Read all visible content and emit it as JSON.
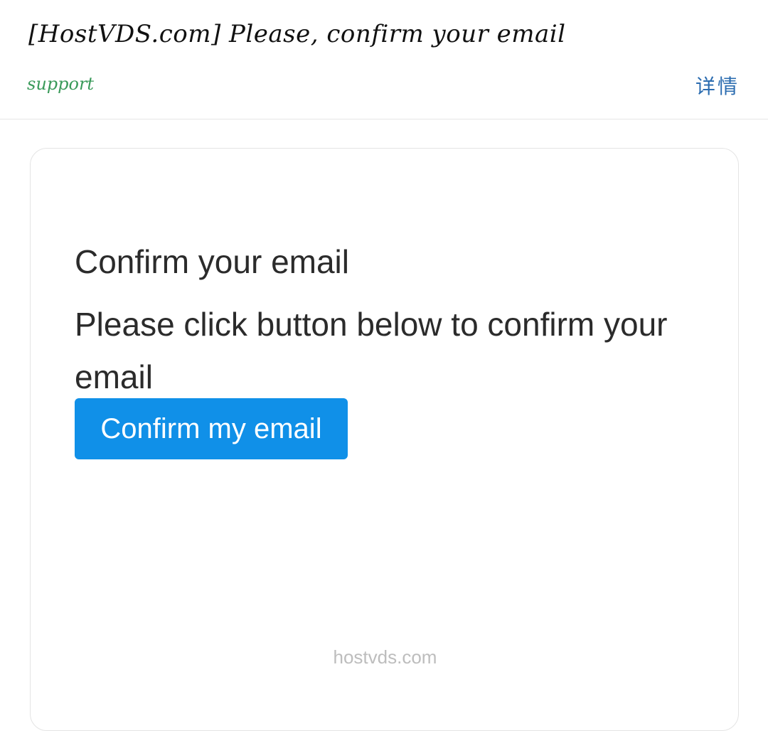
{
  "header": {
    "subject": "[HostVDS.com] Please, confirm your email",
    "sender": "support",
    "details_label": "详情"
  },
  "email": {
    "title": "Confirm your email",
    "body": "Please click button below to confirm your email",
    "button_label": "Confirm my email",
    "footer": "hostvds.com"
  },
  "colors": {
    "button_bg": "#1090e8",
    "sender": "#3a9a5a",
    "details": "#2b6cb0"
  }
}
